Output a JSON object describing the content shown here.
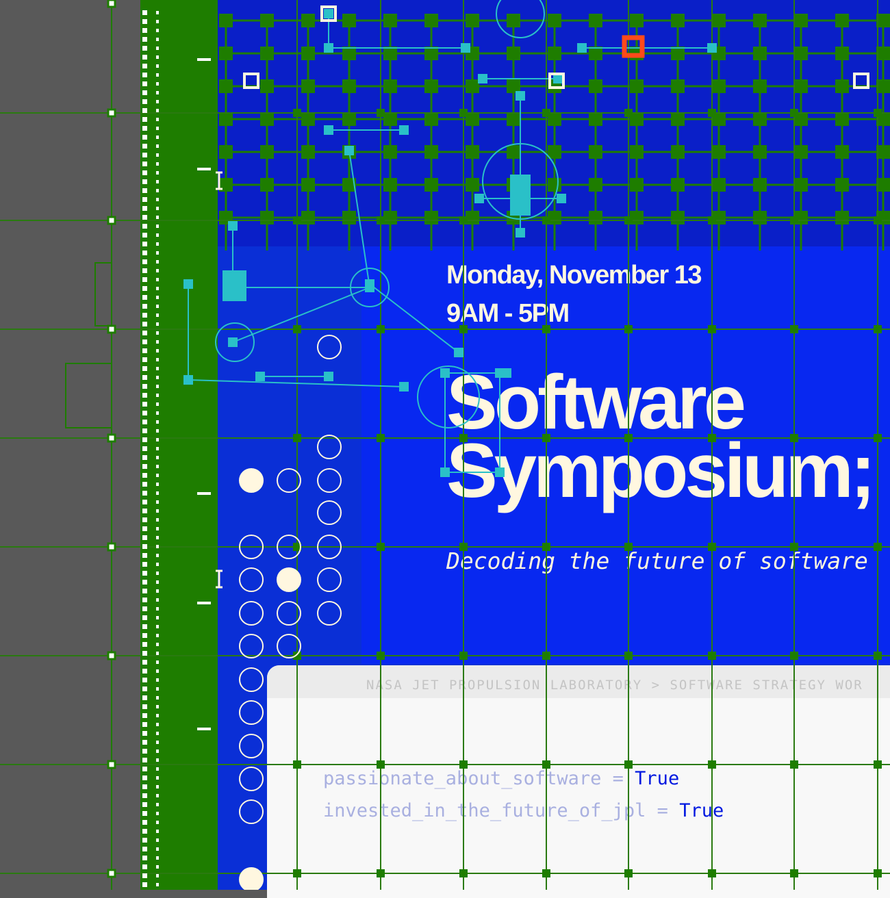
{
  "poster": {
    "date": "Monday, November 13",
    "time": "9AM - 5PM",
    "title_line1": "Software",
    "title_line2": "Symposium;",
    "tagline": "Decoding the future of software"
  },
  "card": {
    "breadcrumb": "NASA JET PROPULSION LABORATORY > SOFTWARE STRATEGY WOR",
    "code_lines": [
      {
        "name": "passionate_about_software",
        "op": " = ",
        "value": "True"
      },
      {
        "name": "invested_in_the_future_of_jpl",
        "op": " = ",
        "value": "True"
      }
    ]
  },
  "colors": {
    "poster_blue": "#0a2fd6",
    "overlay_green": "#1e7d00",
    "selection_cyan": "#2ac0c8",
    "cream_text": "#fff7e0",
    "code_value_blue": "#0018e0",
    "selected_handle_red": "#ff4a1a"
  },
  "icons": [
    "resize-handle-icon",
    "vertical-resize-icon",
    "selection-node-icon"
  ]
}
